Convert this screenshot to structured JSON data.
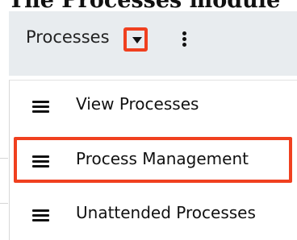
{
  "page_heading": "The Processes module",
  "topbar": {
    "module_label": "Processes"
  },
  "menu": {
    "items": [
      {
        "label": "View Processes",
        "icon": "list-icon"
      },
      {
        "label": "Process Management",
        "icon": "list-icon"
      },
      {
        "label": "Unattended Processes",
        "icon": "list-icon"
      }
    ]
  },
  "colors": {
    "highlight": "#f0401f",
    "topbar_bg": "#e8ecef",
    "text": "#111111"
  }
}
